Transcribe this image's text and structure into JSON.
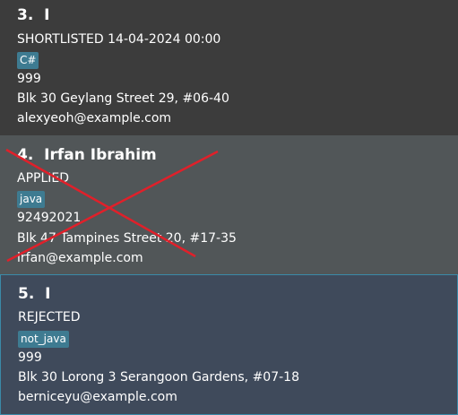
{
  "persons": [
    {
      "index": "3.",
      "name": "I",
      "status": "SHORTLISTED 14-04-2024 00:00",
      "tag": "C#",
      "phone": "999",
      "address": "Blk 30 Geylang Street 29, #06-40",
      "email": "alexyeoh@example.com"
    },
    {
      "index": "4.",
      "name": "Irfan Ibrahim",
      "status": "APPLIED",
      "tag": "java",
      "phone": "92492021",
      "address": "Blk 47 Tampines Street 20, #17-35",
      "email": "irfan@example.com",
      "crossed_out": true
    },
    {
      "index": "5.",
      "name": "I",
      "status": "REJECTED",
      "tag": "not_java",
      "phone": "999",
      "address": "Blk 30 Lorong 3 Serangoon Gardens, #07-18",
      "email": "berniceyu@example.com",
      "selected": true
    }
  ],
  "colors": {
    "card_default": "#3c3c3c",
    "card_alternate": "#515658",
    "card_selected": "#3f4a5b",
    "selected_border": "#3b8aa8",
    "tag_background": "#3e7b91",
    "cross_mark": "#e0202a",
    "text": "#ffffff"
  }
}
